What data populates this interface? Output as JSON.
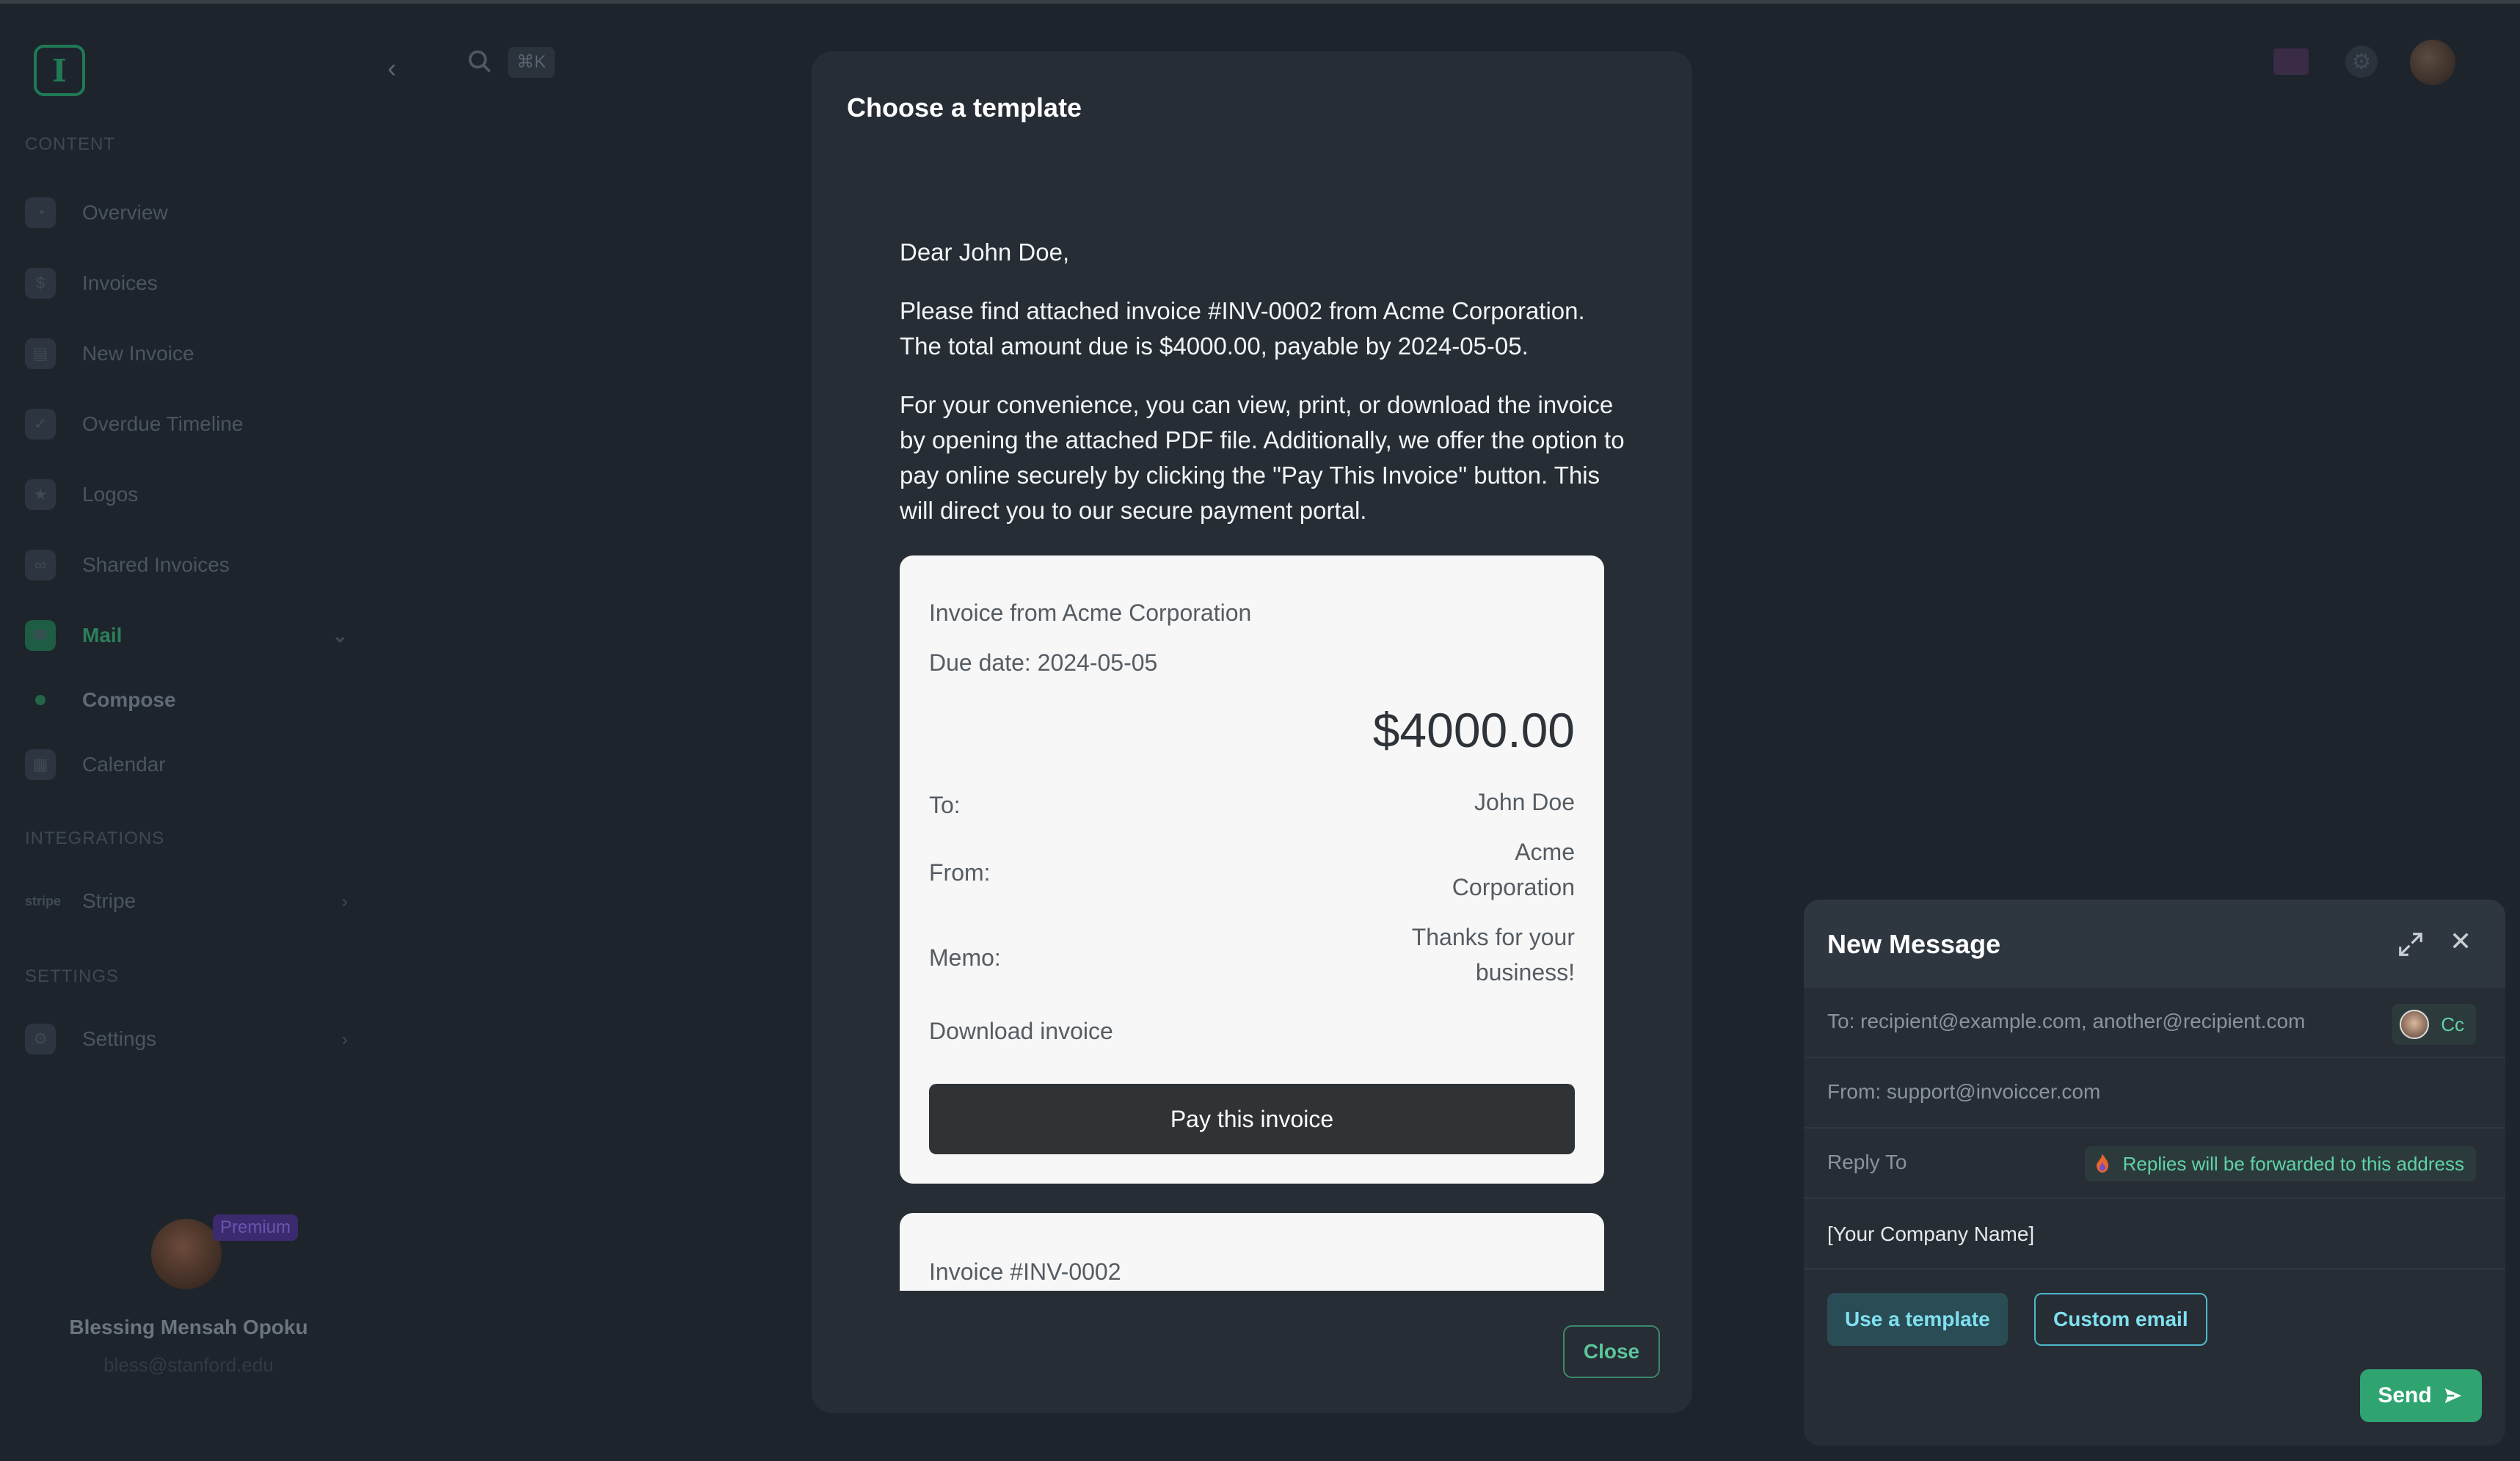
{
  "sidebar": {
    "logo_letter": "I",
    "search_shortcut": "⌘K",
    "sections": {
      "content": "CONTENT",
      "integrations": "INTEGRATIONS",
      "settings": "SETTINGS"
    },
    "items": [
      {
        "label": "Overview",
        "icon": "chart-icon"
      },
      {
        "label": "Invoices",
        "icon": "dollar-icon"
      },
      {
        "label": "New Invoice",
        "icon": "new-invoice-icon"
      },
      {
        "label": "Overdue Timeline",
        "icon": "timeline-icon"
      },
      {
        "label": "Logos",
        "icon": "star-icon"
      },
      {
        "label": "Shared Invoices",
        "icon": "link-icon"
      },
      {
        "label": "Mail",
        "icon": "mail-icon"
      },
      {
        "label": "Compose",
        "icon": "dot-icon"
      },
      {
        "label": "Calendar",
        "icon": "calendar-icon"
      },
      {
        "label": "Stripe",
        "icon": "stripe-icon"
      },
      {
        "label": "Settings",
        "icon": "gear-icon"
      }
    ],
    "stripe_logo": "stripe",
    "user": {
      "badge": "Premium",
      "name": "Blessing Mensah Opoku",
      "email": "bless@stanford.edu"
    }
  },
  "modal": {
    "title": "Choose a template",
    "greeting": "Dear John Doe,",
    "para1": "Please find attached invoice #INV-0002 from Acme Corporation. The total amount due is $4000.00, payable by 2024-05-05.",
    "para2": "For your convenience, you can view, print, or download the invoice by opening the attached PDF file. Additionally, we offer the option to pay online securely by clicking the \"Pay This Invoice\" button. This will direct you to our secure payment portal.",
    "card": {
      "from_line": "Invoice from Acme Corporation",
      "due_line": "Due date: 2024-05-05",
      "amount": "$4000.00",
      "to_label": "To:",
      "to_value": "John Doe",
      "from_label": "From:",
      "from_value": "Acme Corporation",
      "memo_label": "Memo:",
      "memo_value": "Thanks for your business!",
      "download": "Download invoice",
      "pay_button": "Pay this invoice"
    },
    "card2_title": "Invoice #INV-0002",
    "close_button": "Close"
  },
  "compose": {
    "title": "New Message",
    "to": "To: recipient@example.com, another@recipient.com",
    "cc": "Cc",
    "from": "From: support@invoiccer.com",
    "reply_to_label": "Reply To",
    "reply_note": "Replies will be forwarded to this address",
    "company_placeholder": "[Your Company Name]",
    "use_template": "Use a template",
    "custom_email": "Custom email",
    "send": "Send"
  },
  "colors": {
    "background": "#1d242c",
    "modal": "#262d35",
    "accent_green": "#2fa471",
    "accent_cyan": "#7fe0ef"
  }
}
